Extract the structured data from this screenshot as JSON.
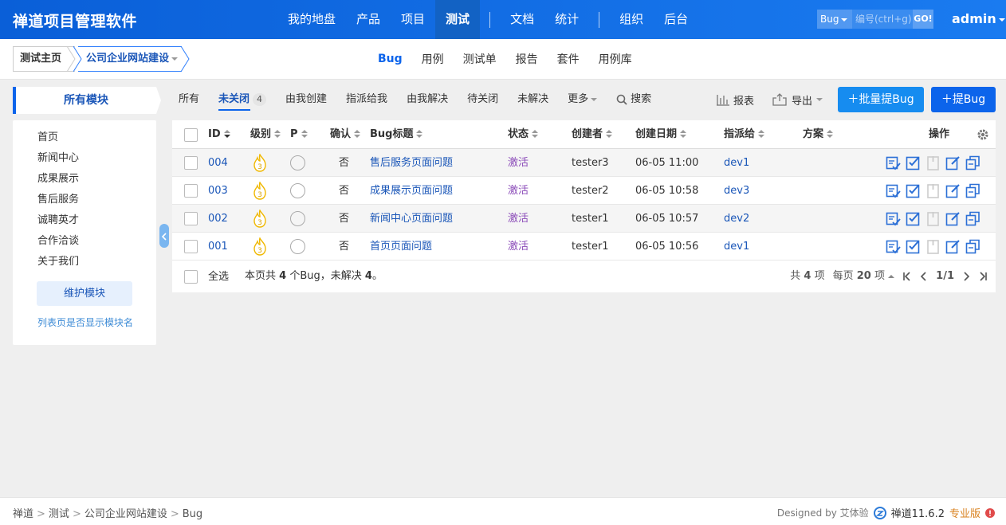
{
  "header": {
    "brand": "禅道项目管理软件",
    "nav": [
      "我的地盘",
      "产品",
      "项目",
      "测试",
      "文档",
      "统计",
      "组织",
      "后台"
    ],
    "active_nav": "测试",
    "search_type": "Bug",
    "search_placeholder": "编号(ctrl+g)",
    "search_go": "GO!",
    "user": "admin"
  },
  "subheader": {
    "crumb_home": "测试主页",
    "crumb_product": "公司企业网站建设",
    "tabs": [
      "Bug",
      "用例",
      "测试单",
      "报告",
      "套件",
      "用例库"
    ],
    "active_tab": "Bug"
  },
  "sidebar": {
    "title": "所有模块",
    "modules": [
      "首页",
      "新闻中心",
      "成果展示",
      "售后服务",
      "诚聘英才",
      "合作洽谈",
      "关于我们"
    ],
    "maintain_button": "维护模块",
    "toggle_link": "列表页是否显示模块名"
  },
  "filters": {
    "all": "所有",
    "unclosed": "未关闭",
    "unclosed_count": "4",
    "created_by_me": "由我创建",
    "assigned_to_me": "指派给我",
    "resolved_by_me": "由我解决",
    "to_close": "待关闭",
    "unresolved": "未解决",
    "more": "更多",
    "search": "搜索"
  },
  "toolbar": {
    "report": "报表",
    "export": "导出",
    "batch_create": "批量提Bug",
    "create": "提Bug"
  },
  "table": {
    "headers": {
      "id": "ID",
      "severity": "级别",
      "priority": "P",
      "confirmed": "确认",
      "title": "Bug标题",
      "status": "状态",
      "creator": "创建者",
      "created_date": "创建日期",
      "assigned_to": "指派给",
      "resolution": "方案",
      "actions": "操作"
    },
    "rows": [
      {
        "id": "004",
        "severity": "3",
        "confirmed": "否",
        "title": "售后服务页面问题",
        "status": "激活",
        "creator": "tester3",
        "date": "06-05 11:00",
        "assigned": "dev1"
      },
      {
        "id": "003",
        "severity": "3",
        "confirmed": "否",
        "title": "成果展示页面问题",
        "status": "激活",
        "creator": "tester2",
        "date": "06-05 10:58",
        "assigned": "dev3"
      },
      {
        "id": "002",
        "severity": "3",
        "confirmed": "否",
        "title": "新闻中心页面问题",
        "status": "激活",
        "creator": "tester1",
        "date": "06-05 10:57",
        "assigned": "dev2"
      },
      {
        "id": "001",
        "severity": "3",
        "confirmed": "否",
        "title": "首页页面问题",
        "status": "激活",
        "creator": "tester1",
        "date": "06-05 10:56",
        "assigned": "dev1"
      }
    ],
    "footer": {
      "select_all": "全选",
      "summary_prefix": "本页共",
      "summary_count": "4",
      "summary_mid": "个Bug，未解决",
      "summary_unresolved": "4",
      "summary_suffix": "。",
      "total_prefix": "共",
      "total_count": "4",
      "total_suffix": "项",
      "per_page_prefix": "每页",
      "per_page": "20",
      "per_page_suffix": "项",
      "page": "1/1"
    }
  },
  "footer": {
    "breadcrumb": [
      "禅道",
      "测试",
      "公司企业网站建设",
      "Bug"
    ],
    "designed_by": "Designed by 艾体验",
    "version": "禅道11.6.2",
    "edition": "专业版"
  },
  "colors": {
    "header_bg": "#0a5fd8",
    "accent": "#0c64eb",
    "link": "#1a56b8",
    "status_active": "#8a4ab8",
    "severity_icon": "#f0b800"
  }
}
